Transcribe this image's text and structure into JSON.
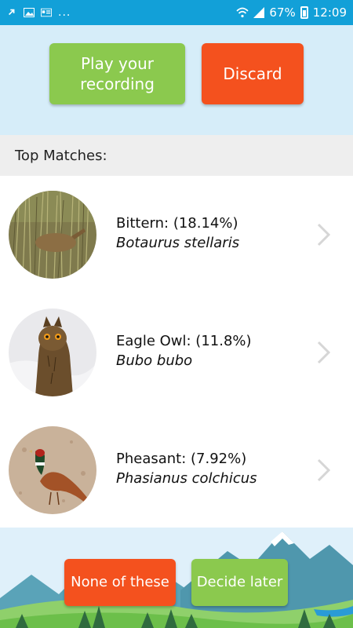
{
  "status_bar": {
    "battery": "67%",
    "time": "12:09",
    "notification_more": "..."
  },
  "actions": {
    "play_label_line1": "Play your",
    "play_label_line2": "recording",
    "discard_label": "Discard"
  },
  "matches_header": "Top Matches:",
  "matches": [
    {
      "common": "Bittern: (18.14%)",
      "latin": "Botaurus stellaris",
      "image": "bittern-photo"
    },
    {
      "common": "Eagle Owl: (11.8%)",
      "latin": "Bubo bubo",
      "image": "eagle-owl-photo"
    },
    {
      "common": "Pheasant: (7.92%)",
      "latin": "Phasianus colchicus",
      "image": "pheasant-photo"
    }
  ],
  "bottom_actions": {
    "none_label": "None of these",
    "later_label": "Decide later"
  },
  "colors": {
    "status_bar": "#12a0d8",
    "top_panel": "#d6edf9",
    "green": "#8bc94e",
    "orange": "#f4511e",
    "header_bg": "#eeeeee"
  }
}
